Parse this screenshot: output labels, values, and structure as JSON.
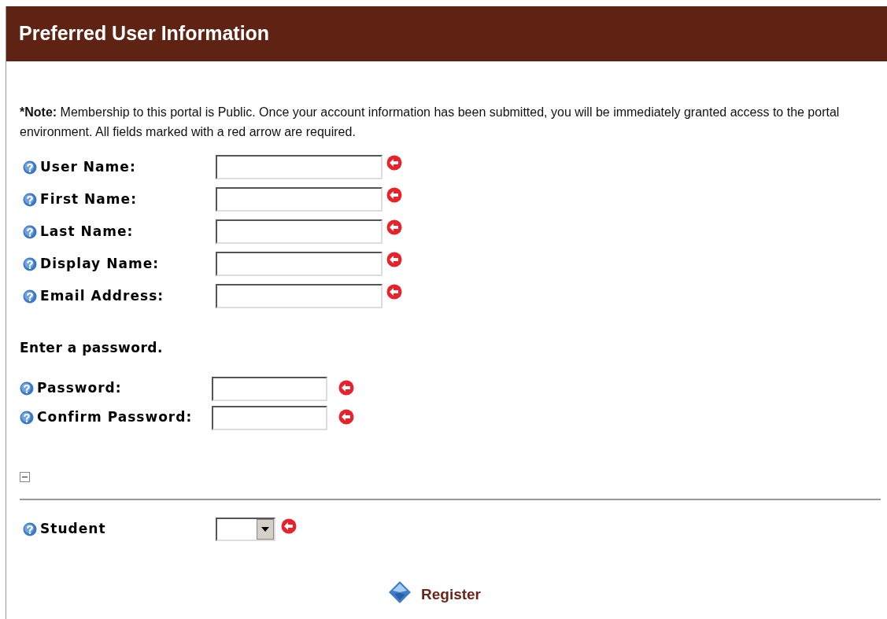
{
  "header": {
    "title": "Preferred User Information"
  },
  "note": {
    "label": "*Note:",
    "text": "Membership to this portal is Public. Once your account information has been submitted, you will be immediately granted access to the portal environment. All fields marked with a red arrow are required."
  },
  "account_fields": [
    {
      "label": "User Name:",
      "required": true
    },
    {
      "label": "First Name:",
      "required": true
    },
    {
      "label": "Last Name:",
      "required": true
    },
    {
      "label": "Display Name:",
      "required": true
    },
    {
      "label": "Email Address:",
      "required": true
    }
  ],
  "password_section": {
    "heading": "Enter a password.",
    "fields": [
      {
        "label": "Password:",
        "required": true
      },
      {
        "label": "Confirm Password:",
        "required": true
      }
    ]
  },
  "profile_section": {
    "expanded": true,
    "fields": [
      {
        "label": "Student",
        "kind": "select",
        "required": true
      }
    ]
  },
  "register_button": {
    "label": "Register"
  }
}
